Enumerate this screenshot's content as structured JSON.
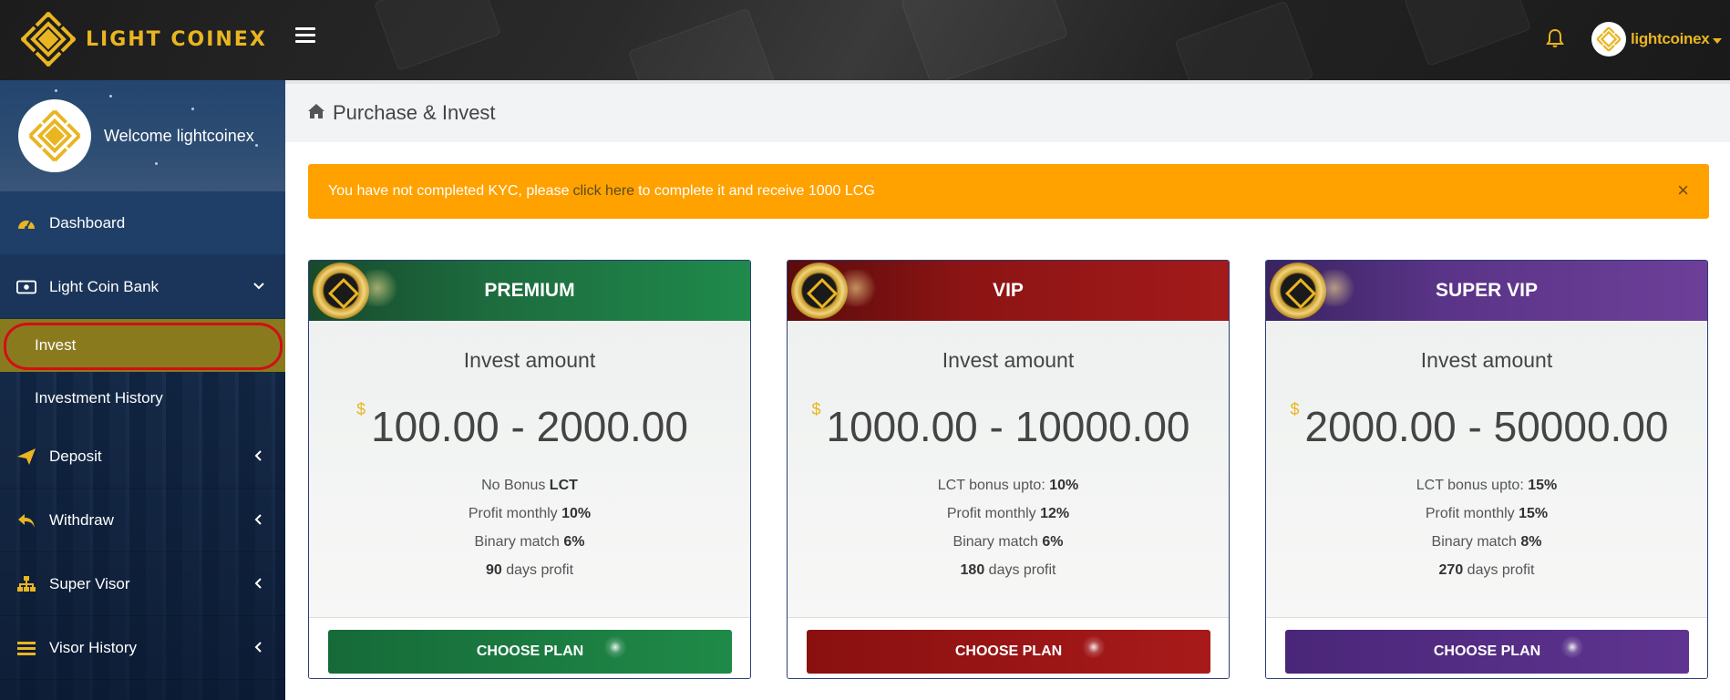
{
  "brand": {
    "name": "LIGHT COINEX",
    "accent": "#e9b521"
  },
  "topbar": {
    "username": "lightcoinex"
  },
  "sidebar": {
    "welcome": "Welcome lightcoinex",
    "items": [
      {
        "label": "Dashboard",
        "icon": "dashboard-icon"
      },
      {
        "label": "Light Coin Bank",
        "icon": "money-icon"
      },
      {
        "label": "Invest"
      },
      {
        "label": "Investment History"
      },
      {
        "label": "Deposit",
        "icon": "paper-plane-icon"
      },
      {
        "label": "Withdraw",
        "icon": "reply-icon"
      },
      {
        "label": "Super Visor",
        "icon": "sitemap-icon"
      },
      {
        "label": "Visor History",
        "icon": "list-icon"
      }
    ]
  },
  "page": {
    "title": "Purchase & Invest"
  },
  "alert": {
    "before": "You have not completed KYC, please",
    "link": "click here",
    "after": "to complete it and receive 1000 LCG",
    "close": "×",
    "color": "#ffa200"
  },
  "plans": [
    {
      "name": "PREMIUM",
      "invest_label": "Invest amount",
      "currency": "$",
      "range": "100.00 - 2000.00",
      "bonus_text": "No Bonus ",
      "bonus_value": "LCT",
      "profit_text": "Profit monthly ",
      "profit_value": "10%",
      "binary_text": "Binary match ",
      "binary_value": "6%",
      "days_value": "90",
      "days_text": " days profit",
      "button": "CHOOSE PLAN",
      "color": "#1f8a48"
    },
    {
      "name": "VIP",
      "invest_label": "Invest amount",
      "currency": "$",
      "range": "1000.00 - 10000.00",
      "bonus_text": "LCT bonus upto: ",
      "bonus_value": "10%",
      "profit_text": "Profit monthly ",
      "profit_value": "12%",
      "binary_text": "Binary match ",
      "binary_value": "6%",
      "days_value": "180",
      "days_text": " days profit",
      "button": "CHOOSE PLAN",
      "color": "#a81a1a"
    },
    {
      "name": "SUPER VIP",
      "invest_label": "Invest amount",
      "currency": "$",
      "range": "2000.00 - 50000.00",
      "bonus_text": "LCT bonus upto: ",
      "bonus_value": "15%",
      "profit_text": "Profit monthly ",
      "profit_value": "15%",
      "binary_text": "Binary match ",
      "binary_value": "8%",
      "days_value": "270",
      "days_text": " days profit",
      "button": "CHOOSE PLAN",
      "color": "#5e3490"
    }
  ]
}
